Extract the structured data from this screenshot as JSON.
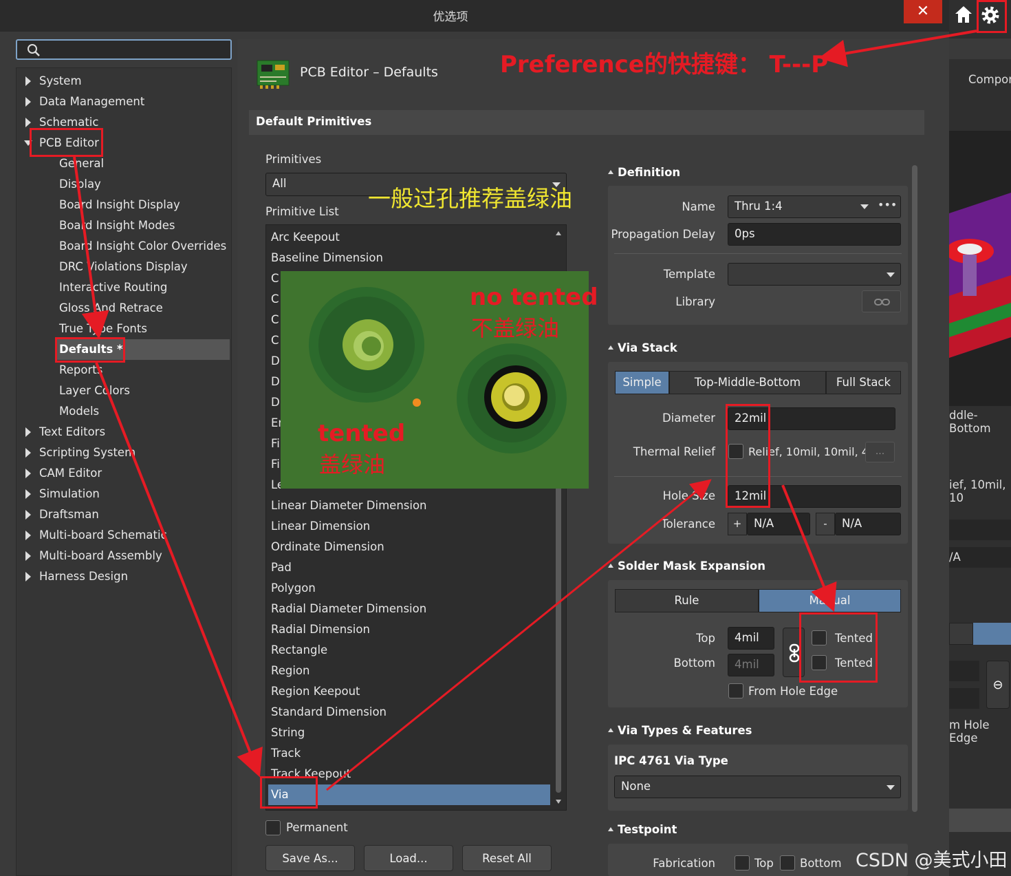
{
  "window": {
    "title": "优选项",
    "close": "✕"
  },
  "left": {
    "search_placeholder": "",
    "tree": [
      {
        "label": "System"
      },
      {
        "label": "Data Management"
      },
      {
        "label": "Schematic"
      },
      {
        "label": "PCB Editor"
      },
      {
        "label": "General"
      },
      {
        "label": "Display"
      },
      {
        "label": "Board Insight Display"
      },
      {
        "label": "Board Insight Modes"
      },
      {
        "label": "Board Insight Color Overrides"
      },
      {
        "label": "DRC Violations Display"
      },
      {
        "label": "Interactive Routing"
      },
      {
        "label": "Gloss And Retrace"
      },
      {
        "label": "True Type Fonts"
      },
      {
        "label": "Defaults *"
      },
      {
        "label": "Reports"
      },
      {
        "label": "Layer Colors"
      },
      {
        "label": "Models"
      },
      {
        "label": "Text Editors"
      },
      {
        "label": "Scripting System"
      },
      {
        "label": "CAM Editor"
      },
      {
        "label": "Simulation"
      },
      {
        "label": "Draftsman"
      },
      {
        "label": "Multi-board Schematic"
      },
      {
        "label": "Multi-board Assembly"
      },
      {
        "label": "Harness Design"
      }
    ]
  },
  "page": {
    "title": "PCB Editor – Defaults",
    "section": "Default Primitives"
  },
  "primitives": {
    "label": "Primitives",
    "selected": "All",
    "list_label": "Primitive List",
    "items": [
      "Arc Keepout",
      "Baseline Dimension",
      "C",
      "C",
      "C",
      "C",
      "D",
      "D",
      "D",
      "Er",
      "Fi",
      "Fi",
      "Leader Dimension",
      "Linear Diameter Dimension",
      "Linear Dimension",
      "Ordinate Dimension",
      "Pad",
      "Polygon",
      "Radial Diameter Dimension",
      "Radial Dimension",
      "Rectangle",
      "Region",
      "Region Keepout",
      "Standard Dimension",
      "String",
      "Track",
      "Track Keepout",
      "Via"
    ],
    "permanent": "Permanent",
    "buttons": {
      "save": "Save As...",
      "load": "Load...",
      "reset": "Reset All"
    }
  },
  "definition": {
    "header": "Definition",
    "name_label": "Name",
    "name_value": "Thru 1:4",
    "delay_label": "Propagation Delay",
    "delay_value": "0ps",
    "template_label": "Template",
    "template_value": "",
    "library_label": "Library"
  },
  "via_stack": {
    "header": "Via Stack",
    "tabs": [
      "Simple",
      "Top-Middle-Bottom",
      "Full Stack"
    ],
    "diameter_label": "Diameter",
    "diameter_value": "22mil",
    "thermal_label": "Thermal Relief",
    "thermal_value": "Relief, 10mil, 10mil, 4,",
    "thermal_more": "...",
    "hole_label": "Hole Size",
    "hole_value": "12mil",
    "tol_label": "Tolerance",
    "tol_plus": "+",
    "tol_plus_value": "N/A",
    "tol_minus": "-",
    "tol_minus_value": "N/A"
  },
  "solder_mask": {
    "header": "Solder Mask Expansion",
    "tabs": [
      "Rule",
      "Manual"
    ],
    "top_label": "Top",
    "top_value": "4mil",
    "bottom_label": "Bottom",
    "bottom_value": "4mil",
    "tented_top": "Tented",
    "tented_bottom": "Tented",
    "from_hole": "From Hole Edge"
  },
  "via_types": {
    "header": "Via Types & Features",
    "ipc_label": "IPC 4761 Via Type",
    "ipc_value": "None"
  },
  "testpoint": {
    "header": "Testpoint",
    "fab_label": "Fabrication",
    "top": "Top",
    "bottom": "Bottom"
  },
  "right_strip": {
    "compo": "Compor",
    "ddle": "ddle-Bottom",
    "ief": "ief, 10mil, 10",
    "va": "/A",
    "mhole": "m Hole Edge"
  },
  "annotations": {
    "shortcut": "Preference的快捷键：  T---P",
    "recommend": "一般过孔推荐盖绿油",
    "no_tented": "no tented",
    "no_tented_cn": "不盖绿油",
    "tented": "tented",
    "tented_cn": "盖绿油",
    "watermark": "CSDN @美式小田"
  },
  "colors": {
    "accent": "#5a7ea6",
    "annotation": "#e51b24",
    "close": "#c42b1c"
  }
}
